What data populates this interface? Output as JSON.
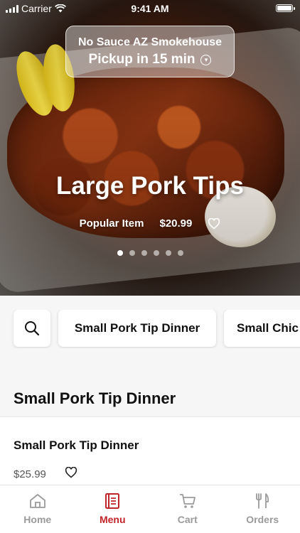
{
  "status_bar": {
    "carrier": "Carrier",
    "time": "9:41 AM"
  },
  "location": {
    "name": "No Sauce AZ Smokehouse",
    "pickup": "Pickup in 15 min"
  },
  "hero": {
    "title": "Large Pork Tips",
    "tag": "Popular Item",
    "price": "$20.99",
    "slide_count": 6,
    "active_slide": 1
  },
  "categories": {
    "items": [
      "Small Pork Tip Dinner",
      "Small Chic"
    ]
  },
  "section": {
    "title": "Small Pork Tip Dinner"
  },
  "menu_item": {
    "name": "Small Pork Tip Dinner",
    "price": "$25.99"
  },
  "tabs": [
    {
      "label": "Home",
      "icon": "home-icon"
    },
    {
      "label": "Menu",
      "icon": "menu-icon",
      "active": true
    },
    {
      "label": "Cart",
      "icon": "cart-icon"
    },
    {
      "label": "Orders",
      "icon": "orders-icon"
    }
  ],
  "colors": {
    "accent": "#c0252a",
    "inactive": "#9b9b9b"
  }
}
